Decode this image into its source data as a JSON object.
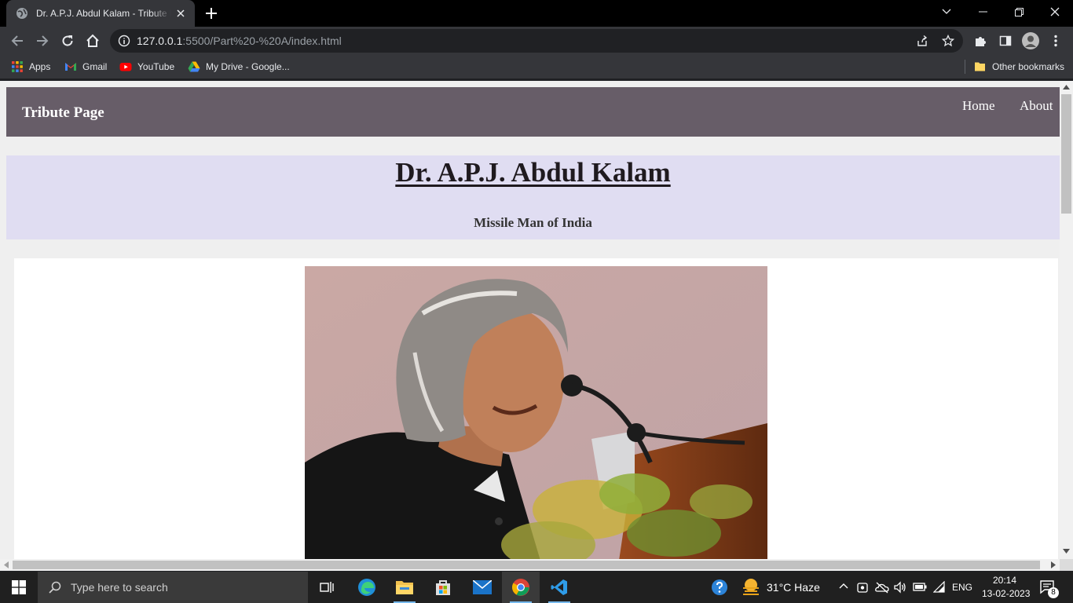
{
  "browser": {
    "tab_title": "Dr. A.P.J. Abdul Kalam - Tribute Page",
    "url_host": "127.0.0.1",
    "url_rest": ":5500/Part%20-%20A/index.html",
    "bookmarks": [
      "Apps",
      "Gmail",
      "YouTube",
      "My Drive - Google..."
    ],
    "other_bookmarks": "Other bookmarks"
  },
  "page": {
    "brand": "Tribute Page",
    "nav_links": [
      "Home",
      "About"
    ],
    "heading": "Dr. A.P.J. Abdul Kalam",
    "subheading": "Missile Man of India"
  },
  "taskbar": {
    "search_placeholder": "Type here to search",
    "weather": "31°C  Haze",
    "language": "ENG",
    "time": "20:14",
    "date": "13-02-2023",
    "notification_count": "8"
  },
  "colors": {
    "navbar": "#675d68",
    "header_band": "#e0ddf2",
    "page_bg": "#efefef"
  }
}
